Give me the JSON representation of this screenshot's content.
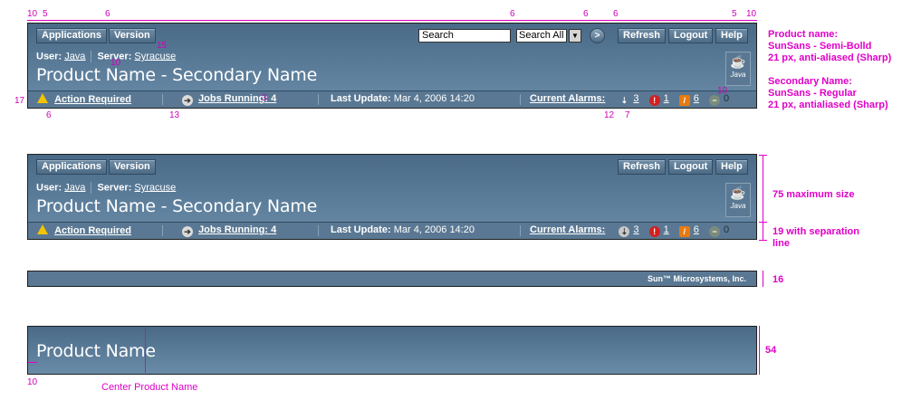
{
  "header": {
    "nav_buttons": [
      "Applications",
      "Version"
    ],
    "user_label": "User:",
    "user_value": "Java",
    "server_label": "Server:",
    "server_value": "Syracuse",
    "product_title": "Product Name - Secondary Name",
    "search_placeholder": "Search",
    "search_scope": "Search All",
    "search_go": ">",
    "right_buttons": [
      "Refresh",
      "Logout",
      "Help"
    ],
    "java_logo_text": "Java"
  },
  "status_bar": {
    "action_required": "Action Required",
    "jobs_running_label": "Jobs Running:",
    "jobs_running_count": "4",
    "last_update_label": "Last Update:",
    "last_update_value": "Mar 4, 2006 14:20",
    "current_alarms_label": "Current Alarms:",
    "alarms": [
      {
        "icon": "down-arrow-alarm-icon",
        "count": "3",
        "color": "#c8c8c8"
      },
      {
        "icon": "critical-alarm-icon",
        "count": "1",
        "color": "#d42020"
      },
      {
        "icon": "major-alarm-icon",
        "count": "6",
        "color": "#e87a10"
      },
      {
        "icon": "minor-alarm-icon",
        "count": "0",
        "color": "#7c8c7c"
      }
    ]
  },
  "footer": {
    "company": "Sun™ Microsystems, Inc."
  },
  "minimal_masthead": {
    "title": "Product Name"
  },
  "annotations": {
    "product_name_note": "Product name:\nSunSans - Semi-Bolld\n21 px, anti-aliased (Sharp)",
    "secondary_name_note": "Secondary Name:\nSunSans - Regular\n21 px, antialiased (Sharp)",
    "max_size": "75 maximum size",
    "separation": "19 with separation\nline",
    "footer_height": "16",
    "minimal_height": "54",
    "left_pad": "10",
    "center_note": "Center Product Name",
    "top_numbers": [
      "10",
      "5",
      "6",
      "6",
      "6",
      "6",
      "5",
      "10"
    ],
    "misc_numbers": [
      "15",
      "10",
      "17",
      "6",
      "13",
      "3",
      "12",
      "7",
      "10"
    ]
  },
  "colors": {
    "masthead": "#5d7f9c",
    "annotation": "#e000c8"
  }
}
